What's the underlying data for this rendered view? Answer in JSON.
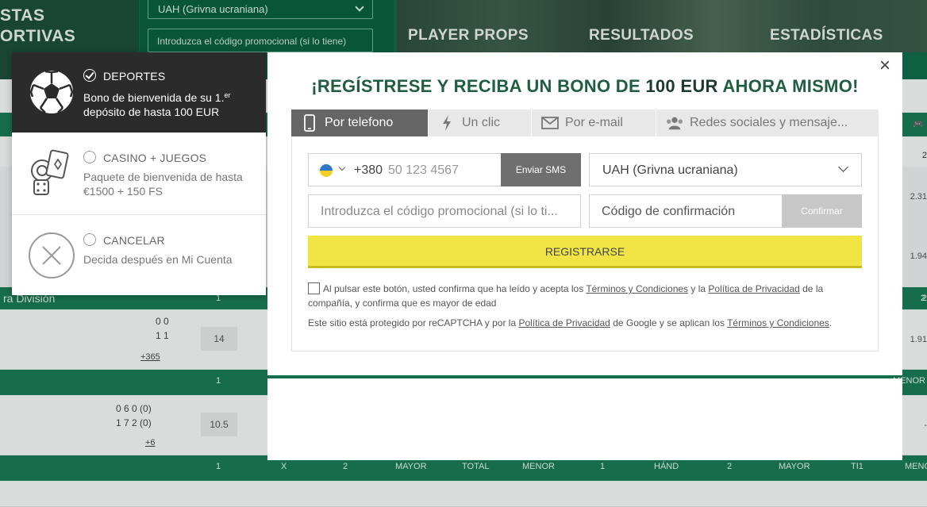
{
  "background": {
    "banner_left": {
      "line1": "STAS",
      "line2": "ORTIVAS"
    },
    "banner_form": {
      "currency": "UAH (Grivna ucraniana)",
      "promo_placeholder": "Introduzca el código promocional (si lo tiene)"
    },
    "tiles": [
      "PLAYER PROPS",
      "RESULTADOS",
      "ESTADÍSTICAS"
    ],
    "league_label": "ra División",
    "table_headers": [
      "1",
      "X",
      "2",
      "MAYOR",
      "TOTAL",
      "MENOR",
      "1",
      "HÁND",
      "2",
      "MAYOR",
      "TI1",
      "MENO"
    ],
    "rows": [
      {
        "score_a": "0  0",
        "score_b": "1  1",
        "cell": "14",
        "more": "+365",
        "odds": "1.91"
      },
      {
        "score_a": "0   6   0  (0)",
        "score_b": "1   7   2  (0)",
        "cell": "10.5",
        "more": "+6",
        "odds": "-"
      }
    ],
    "side_odds": [
      "2",
      "2.31",
      "1.94",
      "2"
    ],
    "strip_numbers": [
      "1",
      "2",
      "MENOR"
    ]
  },
  "bonus_panel": {
    "options": [
      {
        "title": "DEPORTES",
        "desc_line1": "Bono de bienvenida de su 1.",
        "desc_sup": "er",
        "desc_line2": "depósito de hasta 100 EUR",
        "selected": true,
        "icon": "soccer-ball-icon"
      },
      {
        "title": "CASINO + JUEGOS",
        "desc": "Paquete de bienvenida de hasta €1500 + 150 FS",
        "selected": false,
        "icon": "casino-chips-dice-icon"
      },
      {
        "title": "CANCELAR",
        "desc": "Decida después en Mi Cuenta",
        "selected": false,
        "icon": "close-circle-icon"
      }
    ]
  },
  "modal": {
    "title_pre": "¡REGÍSTRESE Y RECIBA UN BONO DE ",
    "title_amount": "100 EUR",
    "title_post": " AHORA MISMO!",
    "close_label": "×",
    "tabs": [
      {
        "label": "Por telefono",
        "icon": "phone-icon",
        "active": true
      },
      {
        "label": "Un clic",
        "icon": "lightning-icon",
        "active": false
      },
      {
        "label": "Por e-mail",
        "icon": "envelope-icon",
        "active": false
      },
      {
        "label": "Redes sociales y mensaje...",
        "icon": "users-icon",
        "active": false
      }
    ],
    "phone": {
      "prefix": "+380",
      "placeholder": "50 123 4567",
      "send_sms": "Enviar SMS"
    },
    "currency": "UAH (Grivna ucraniana)",
    "promo_placeholder": "Introduzca el código promocional (si lo ti...",
    "confirmation_placeholder": "Código de confirmación",
    "confirm_button": "Confirmar",
    "register_button": "REGISTRARSE",
    "terms": {
      "t1": "Al pulsar este botón, usted confirma que ha leído y acepta los ",
      "link1": "Términos y Condiciones",
      "t2": " y la ",
      "link2": "Política de Privacidad",
      "t3": " de la compañía, y confirma que es mayor de edad"
    },
    "captcha": {
      "t1": "Este sitio está protegido por reCAPTCHA y por la ",
      "link1": "Política de Privacidad",
      "t2": " de Google y se aplican los ",
      "link2": "Términos y Condiciones",
      "t3": "."
    }
  },
  "colors": {
    "brand_green": "#0f6b4a",
    "title_green": "#1f5e3f",
    "register_yellow": "#f1e445"
  }
}
